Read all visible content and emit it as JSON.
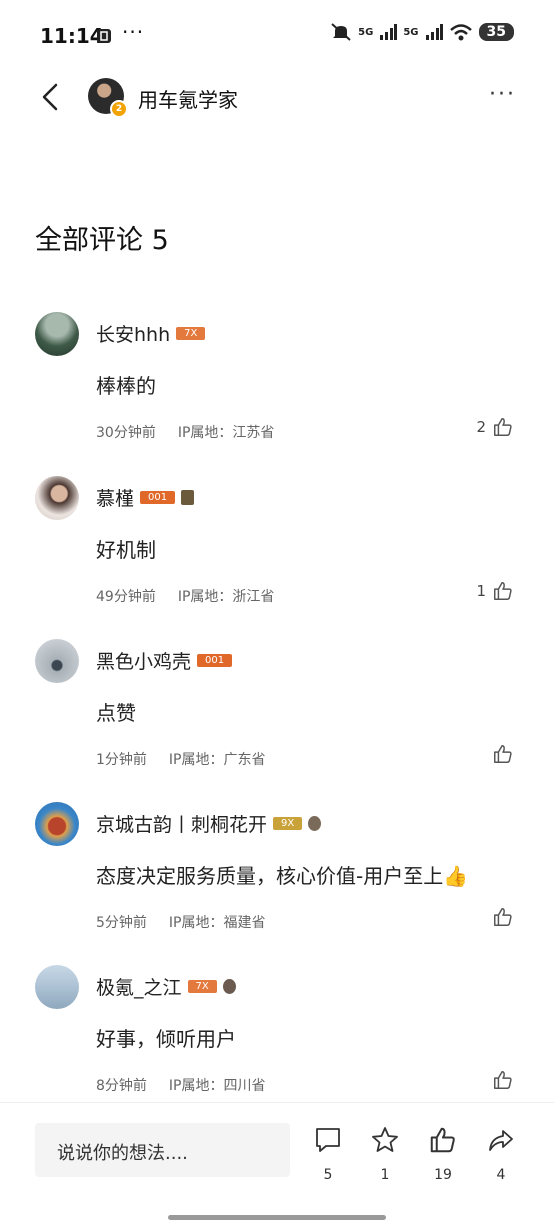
{
  "status_bar": {
    "time": "11:14",
    "dots": "···",
    "network1": "5G",
    "network2": "5G",
    "battery": "35"
  },
  "header": {
    "title": "用车氪学家",
    "avatar_badge": "2",
    "more": "···"
  },
  "section": {
    "title": "全部评论 5"
  },
  "comments": [
    {
      "user": "长安hhh",
      "badge": "7X",
      "badge_color": "#e3793c",
      "text": "棒棒的",
      "time": "30分钟前",
      "ip": "IP属地：江苏省",
      "likes": "2"
    },
    {
      "user": "慕槿",
      "badge": "001",
      "badge_color": "#e0692a",
      "text": "好机制",
      "time": "49分钟前",
      "ip": "IP属地：浙江省",
      "likes": "1"
    },
    {
      "user": "黑色小鸡壳",
      "badge": "001",
      "badge_color": "#e0692a",
      "text": "点赞",
      "time": "1分钟前",
      "ip": "IP属地：广东省",
      "likes": ""
    },
    {
      "user": "京城古韵丨刺桐花开",
      "badge": "9X",
      "badge_color": "#c9a23a",
      "text": "态度决定服务质量，核心价值-用户至上👍",
      "time": "5分钟前",
      "ip": "IP属地：福建省",
      "likes": ""
    },
    {
      "user": "极氪_之江",
      "badge": "7X",
      "badge_color": "#e3793c",
      "text": "好事，倾听用户",
      "time": "8分钟前",
      "ip": "IP属地：四川省",
      "likes": ""
    }
  ],
  "bottom_bar": {
    "placeholder": "说说你的想法....",
    "comment_count": "5",
    "favorite_count": "1",
    "like_count": "19",
    "share_count": "4"
  }
}
